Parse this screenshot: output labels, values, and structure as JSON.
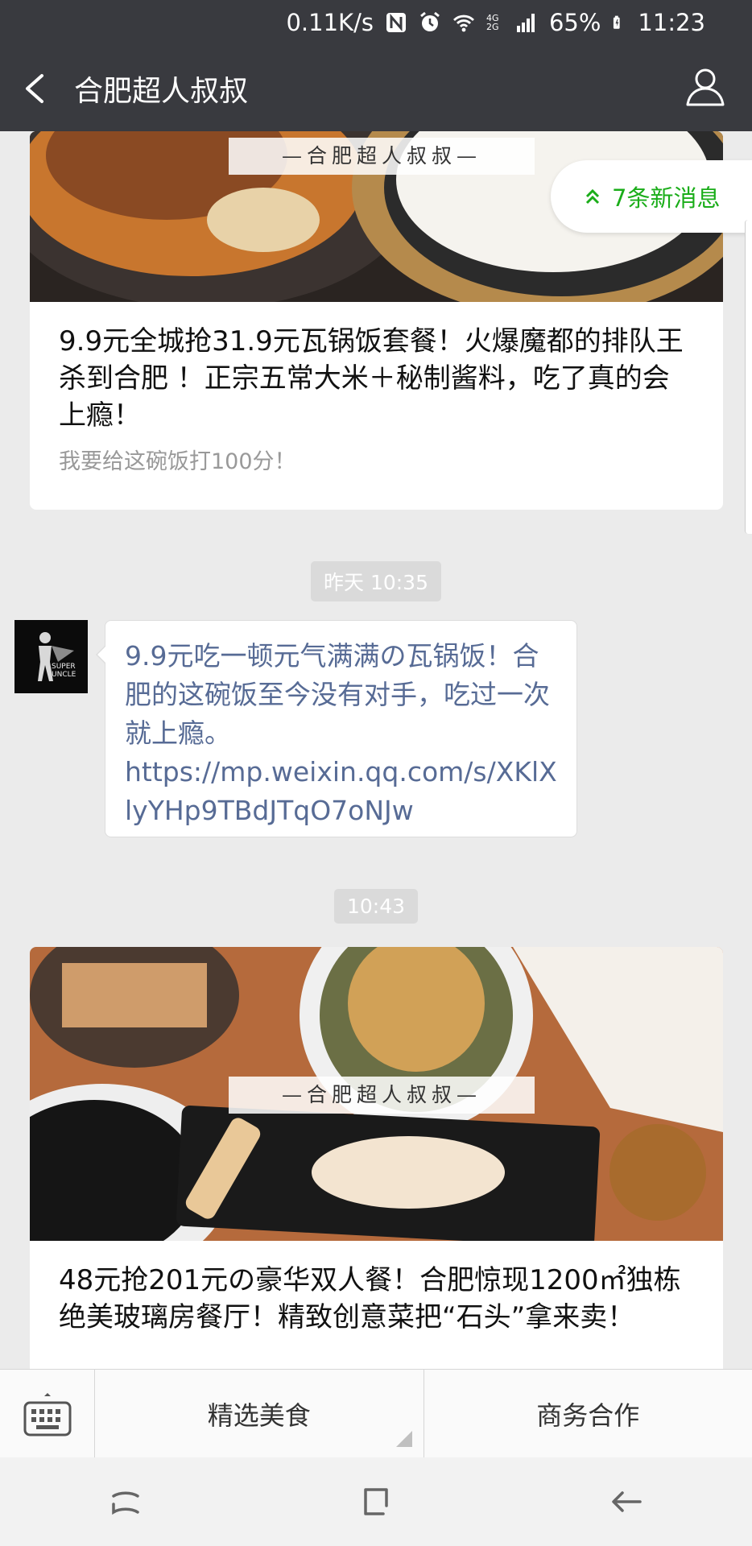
{
  "status_bar": {
    "network_speed": "0.11K/s",
    "signal_badge": "4G 2G",
    "battery": "65%",
    "time": "11:23"
  },
  "header": {
    "title": "合肥超人叔叔",
    "back_icon": "back-arrow-icon",
    "profile_icon": "person-icon"
  },
  "new_messages": {
    "label": "7条新消息"
  },
  "articles": [
    {
      "watermark": "—合肥超人叔叔—",
      "title": "9.9元全城抢31.9元瓦锅饭套餐！火爆魔都的排队王杀到合肥 ！正宗五常大米＋秘制酱料，吃了真的会上瘾！",
      "description": "我要给这碗饭打100分！"
    },
    {
      "watermark": "—合肥超人叔叔—",
      "title": "48元抢201元の豪华双人餐！合肥惊现1200㎡独栋绝美玻璃房餐厅！精致创意菜把“石头”拿来卖！"
    }
  ],
  "timestamps": [
    "昨天 10:35",
    "10:43"
  ],
  "message": {
    "text": "9.9元吃一顿元气满满の瓦锅饭！合肥的这碗饭至今没有对手，吃过一次就上瘾。",
    "link": "https://mp.weixin.qq.com/s/XKlXlyYHp9TBdJTqO7oNJw",
    "avatar_text_1": "SUPER",
    "avatar_text_2": "UNCLE"
  },
  "bottom_menu": {
    "keyboard_icon": "keyboard-icon",
    "items": [
      "精选美食",
      "商务合作"
    ]
  },
  "nav_bar": {
    "icons": [
      "recent-apps-icon",
      "home-icon",
      "back-icon"
    ]
  },
  "colors": {
    "header_bg": "#393a3f",
    "chat_bg": "#ebebeb",
    "accent_green": "#1aad19",
    "link_blue": "#576b95"
  }
}
